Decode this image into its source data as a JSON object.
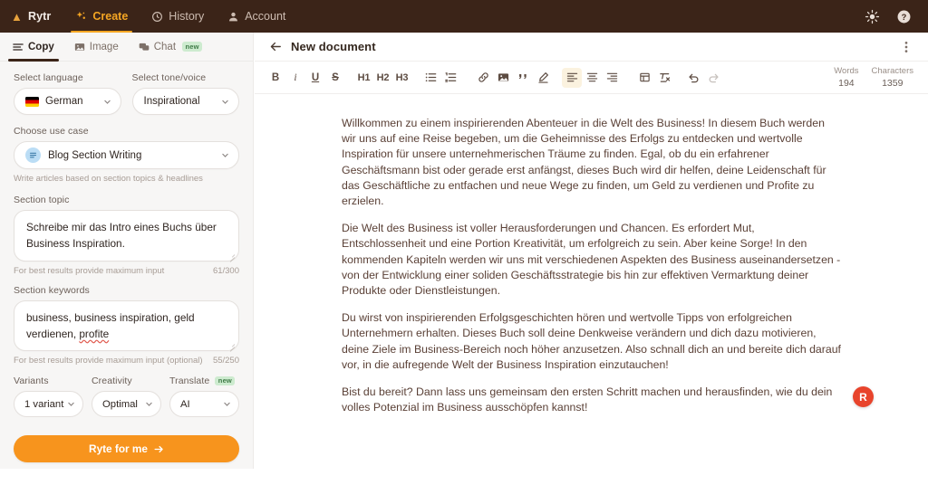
{
  "header": {
    "brand": "Rytr",
    "nav": [
      {
        "label": "Create",
        "icon": "sparkle-icon",
        "active": true
      },
      {
        "label": "History",
        "icon": "clock-icon",
        "active": false
      },
      {
        "label": "Account",
        "icon": "person-icon",
        "active": false
      }
    ],
    "actions": [
      {
        "name": "theme-toggle",
        "icon": "sun-icon"
      },
      {
        "name": "help",
        "icon": "question-circle-icon"
      }
    ]
  },
  "sidebar": {
    "tabs": [
      {
        "label": "Copy",
        "icon": "lines-icon",
        "active": true,
        "badge": ""
      },
      {
        "label": "Image",
        "icon": "image-icon",
        "active": false,
        "badge": ""
      },
      {
        "label": "Chat",
        "icon": "chat-icon",
        "active": false,
        "badge": "new"
      }
    ],
    "language": {
      "label": "Select language",
      "value": "German",
      "flag": "de"
    },
    "tone": {
      "label": "Select tone/voice",
      "value": "Inspirational"
    },
    "use_case": {
      "label": "Choose use case",
      "value": "Blog Section Writing",
      "hint": "Write articles based on section topics & headlines"
    },
    "section_topic": {
      "label": "Section topic",
      "value": "Schreibe mir das Intro eines Buchs über Business Inspiration.",
      "placeholder": "Section topic",
      "hint": "For best results provide maximum input",
      "counter": "61/300"
    },
    "section_keywords": {
      "label": "Section keywords",
      "value_part1": "business, business inspiration, geld verdienen, ",
      "value_misspelled": "profite",
      "placeholder": "Section keywords",
      "hint": "For best results provide maximum input (optional)",
      "counter": "55/250"
    },
    "variants": {
      "label": "Variants",
      "value": "1 variant"
    },
    "creativity": {
      "label": "Creativity",
      "value": "Optimal"
    },
    "translate": {
      "label": "Translate",
      "badge": "new",
      "value": "AI"
    },
    "cta": {
      "label": "Ryte for me"
    }
  },
  "editor": {
    "back_icon": "arrow-left-icon",
    "title": "New document",
    "menu_icon": "kebab-menu-icon",
    "toolbar": {
      "bold": "B",
      "italic": "i",
      "underline": "U",
      "strikethrough": "S",
      "h1": "H1",
      "h2": "H2",
      "h3": "H3",
      "icons": [
        "bulleted-list-icon",
        "numbered-list-icon",
        "link-icon",
        "image-icon",
        "quote-icon",
        "highlighter-icon",
        "align-left-icon",
        "align-center-icon",
        "align-right-icon",
        "table-icon",
        "clear-format-icon",
        "undo-icon",
        "redo-icon"
      ]
    },
    "counters": [
      {
        "label": "Words",
        "value": "194"
      },
      {
        "label": "Characters",
        "value": "1359"
      }
    ],
    "document": {
      "paragraphs": [
        "Willkommen zu einem inspirierenden Abenteuer in die Welt des Business! In diesem Buch werden wir uns auf eine Reise begeben, um die Geheimnisse des Erfolgs zu entdecken und wertvolle Inspiration für unsere unternehmerischen Träume zu finden. Egal, ob du ein erfahrener Geschäftsmann bist oder gerade erst anfängst, dieses Buch wird dir helfen, deine Leidenschaft für das Geschäftliche zu entfachen und neue Wege zu finden, um Geld zu verdienen und Profite zu erzielen.",
        "Die Welt des Business ist voller Herausforderungen und Chancen. Es erfordert Mut, Entschlossenheit und eine Portion Kreativität, um erfolgreich zu sein. Aber keine Sorge! In den kommenden Kapiteln werden wir uns mit verschiedenen Aspekten des Business auseinandersetzen - von der Entwicklung einer soliden Geschäftsstrategie bis hin zur effektiven Vermarktung deiner Produkte oder Dienstleistungen.",
        "Du wirst von inspirierenden Erfolgsgeschichten hören und wertvolle Tipps von erfolgreichen Unternehmern erhalten. Dieses Buch soll deine Denkweise verändern und dich dazu motivieren, deine Ziele im Business-Bereich noch höher anzusetzen. Also schnall dich an und bereite dich darauf vor, in die aufregende Welt der Business Inspiration einzutauchen!",
        "Bist du bereit? Dann lass uns gemeinsam den ersten Schritt machen und herausfinden, wie du dein volles Potenzial im Business ausschöpfen kannst!"
      ]
    },
    "fab": {
      "label": "R",
      "name": "rytr-assistant-button"
    }
  },
  "colors": {
    "header_bg": "#3B2418",
    "accent_orange": "#F5A623",
    "cta_orange": "#F7941D",
    "sidebar_bg": "#F7F6F5",
    "text_body": "#5A4036",
    "fab_red": "#E8442C",
    "badge_new_bg": "#CDEBCF"
  }
}
